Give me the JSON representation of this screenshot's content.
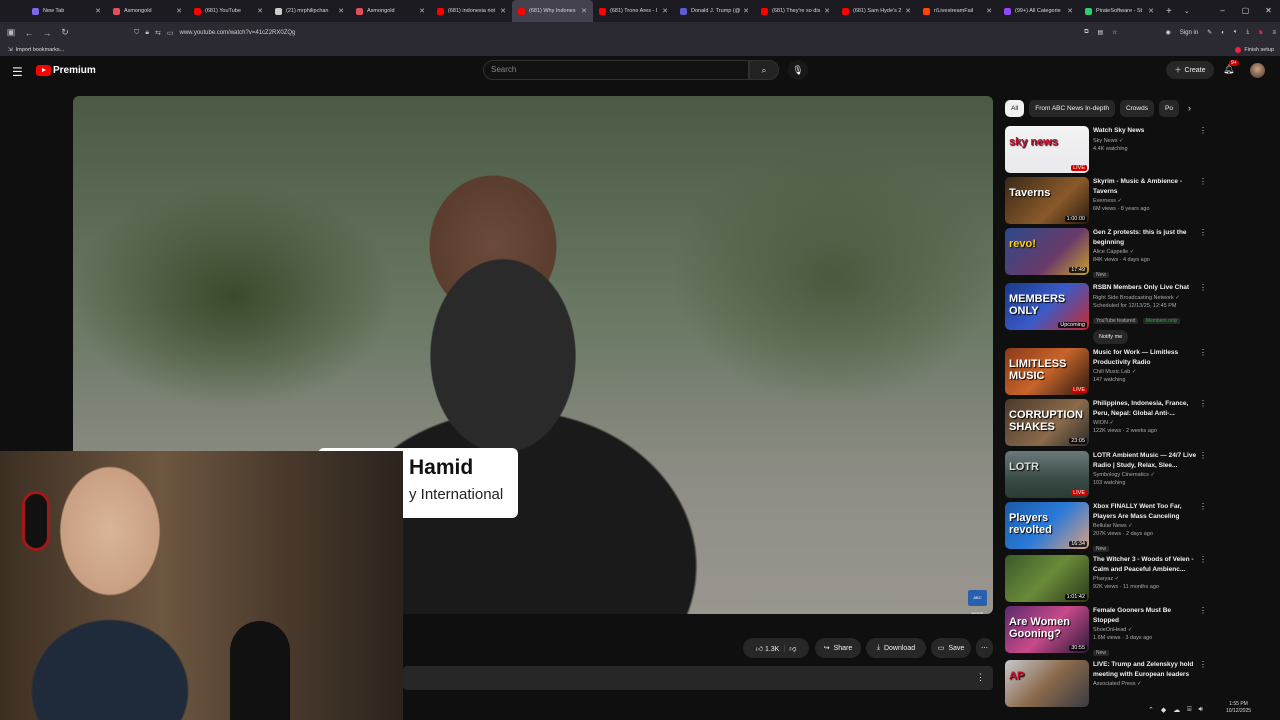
{
  "browser": {
    "tabs": [
      {
        "label": "New Tab",
        "color": "#7b68ee",
        "active": false
      },
      {
        "label": "Asmongold",
        "color": "#e24f5a",
        "active": false
      },
      {
        "label": "(681) YouTube",
        "color": "#ff0000",
        "active": false
      },
      {
        "label": "(21) mrphilipchan",
        "color": "#cccccc",
        "active": false
      },
      {
        "label": "Asmongold",
        "color": "#e24f5a",
        "active": false
      },
      {
        "label": "(681) indonesia riot",
        "color": "#ff0000",
        "active": false
      },
      {
        "label": "(681) Why Indones",
        "color": "#ff0000",
        "active": true
      },
      {
        "label": "(681) Trono Ares - I",
        "color": "#ff0000",
        "active": false
      },
      {
        "label": "Donald J. Trump (@",
        "color": "#5b5bd6",
        "active": false
      },
      {
        "label": "(681) They're so dis",
        "color": "#ff0000",
        "active": false
      },
      {
        "label": "(681) Sam Hyde's 2",
        "color": "#ff0000",
        "active": false
      },
      {
        "label": "r/LivestreamFail",
        "color": "#ff4500",
        "active": false
      },
      {
        "label": "(99+) All Categorie",
        "color": "#9146ff",
        "active": false
      },
      {
        "label": "PirateSoftware - St",
        "color": "#2ecc71",
        "active": false
      }
    ],
    "new_tab_symbol": "+",
    "url": "www.youtube.com/watch?v=41cZ2RX0ZQg",
    "sign_in_label": "Sign in",
    "import_bookmarks": "Import bookmarks...",
    "finish_setup": "Finish setup"
  },
  "youtube": {
    "brand": "Premium",
    "search_placeholder": "Search",
    "create_label": "Create",
    "notif_count": "9+"
  },
  "video": {
    "lower_third_name": "Hamid",
    "lower_third_org": "y International",
    "watermark": "ABC NEWS"
  },
  "actions": {
    "likes": "1.3K",
    "share": "Share",
    "download": "Download",
    "save": "Save"
  },
  "chips": [
    "All",
    "From ABC News In-depth",
    "Crowds",
    "Po"
  ],
  "recommendations": [
    {
      "title": "Watch Sky News",
      "channel": "Sky News",
      "stats": "4.4K watching",
      "badge": "",
      "badge2": "",
      "overlay": "LIVE",
      "overlay_type": "live",
      "thumb_text": "sky news",
      "thumb_bg": "linear-gradient(180deg,#f4f4f4 0%,#e8e8ee 100%)",
      "thumb_color": "#c8102e"
    },
    {
      "title": "Skyrim - Music & Ambience - Taverns",
      "channel": "Everness",
      "stats": "6M views · 8 years ago",
      "badge": "",
      "badge2": "",
      "overlay": "1:00:00",
      "overlay_type": "dur",
      "thumb_text": "Taverns",
      "thumb_bg": "linear-gradient(135deg,#3a2818 0%,#8a5a2a 60%,#2a1a10 100%)",
      "thumb_color": "#fff"
    },
    {
      "title": "Gen Z protests: this is just the beginning",
      "channel": "Alice Cappelle",
      "stats": "84K views · 4 days ago",
      "badge": "New",
      "badge2": "",
      "overlay": "17:49",
      "overlay_type": "dur",
      "thumb_text": "revo!",
      "thumb_bg": "linear-gradient(135deg,#2b4a8a 0%,#6a3a6a 60%,#c7a02a 100%)",
      "thumb_color": "#ffd400"
    },
    {
      "title": "RSBN Members Only Live Chat",
      "channel": "Right Side Broadcasting Network",
      "stats": "Scheduled for 12/13/25, 12:45 PM",
      "badge": "YouTube featured",
      "badge2": "Members only",
      "overlay": "Upcoming",
      "overlay_type": "upc",
      "thumb_text": "MEMBERS ONLY",
      "thumb_bg": "linear-gradient(135deg,#1a3a8a 0%,#3a5ac8 50%,#c82a2a 100%)",
      "thumb_color": "#fff"
    },
    {
      "title": "Music for Work — Limitless Productivity Radio",
      "channel": "Chill Music Lab",
      "stats": "147 watching",
      "badge": "",
      "badge2": "",
      "overlay": "LIVE",
      "overlay_type": "live",
      "thumb_text": "LIMITLESS MUSIC",
      "thumb_bg": "linear-gradient(135deg,#8a3a1a 0%,#c8642a 50%,#2a1a10 100%)",
      "thumb_color": "#fff"
    },
    {
      "title": "Philippines, Indonesia, France, Peru, Nepal: Global Anti-...",
      "channel": "WION",
      "stats": "122K views · 2 weeks ago",
      "badge": "",
      "badge2": "",
      "overlay": "23:05",
      "overlay_type": "dur",
      "thumb_text": "CORRUPTION SHAKES",
      "thumb_bg": "linear-gradient(135deg,#4a3a2a 0%,#8a6a4a 60%,#2a2a2a 100%)",
      "thumb_color": "#fff"
    },
    {
      "title": "LOTR Ambient Music — 24/7 Live Radio | Study, Relax, Slee...",
      "channel": "Symbology Cinematics",
      "stats": "103 watching",
      "badge": "",
      "badge2": "",
      "overlay": "LIVE",
      "overlay_type": "live",
      "thumb_text": "LOTR",
      "thumb_bg": "linear-gradient(180deg,#6a7a7a 0%,#3a4a44 60%,#2a3a34 100%)",
      "thumb_color": "#ddd"
    },
    {
      "title": "Xbox FINALLY Went Too Far, Players Are Mass Canceling",
      "channel": "Bellular News",
      "stats": "207K views · 2 days ago",
      "badge": "New",
      "badge2": "",
      "overlay": "16:34",
      "overlay_type": "dur",
      "thumb_text": "Players revolted",
      "thumb_bg": "linear-gradient(135deg,#1a5aa8 0%,#2a7ad8 50%,#d8a080 100%)",
      "thumb_color": "#fff"
    },
    {
      "title": "The Witcher 3 - Woods of Velen - Calm and Peaceful Ambienc...",
      "channel": "Pharyaz",
      "stats": "92K views · 11 months ago",
      "badge": "",
      "badge2": "",
      "overlay": "1:01:42",
      "overlay_type": "dur",
      "thumb_text": "",
      "thumb_bg": "linear-gradient(135deg,#3a5a2a 0%,#6a8a3a 50%,#2a3a1a 100%)",
      "thumb_color": "#fff"
    },
    {
      "title": "Female Gooners Must Be Stopped",
      "channel": "ShoeOnHead",
      "stats": "1.6M views · 3 days ago",
      "badge": "New",
      "badge2": "",
      "overlay": "30:55",
      "overlay_type": "dur",
      "thumb_text": "Are Women Gooning?",
      "thumb_bg": "linear-gradient(135deg,#5a2a6a 0%,#c84a8a 50%,#2a1a3a 100%)",
      "thumb_color": "#fff"
    },
    {
      "title": "LIVE: Trump and Zelenskyy hold meeting with European leaders",
      "channel": "Associated Press",
      "stats": "",
      "badge": "",
      "badge2": "",
      "overlay": "",
      "overlay_type": "",
      "thumb_text": "AP",
      "thumb_bg": "linear-gradient(135deg,#c8c8d0 0%,#8a6a4a 50%,#3a3a44 100%)",
      "thumb_color": "#c8102e"
    }
  ],
  "notify_label": "Notify me",
  "system": {
    "time": "1:55 PM",
    "date": "10/12/2025"
  }
}
